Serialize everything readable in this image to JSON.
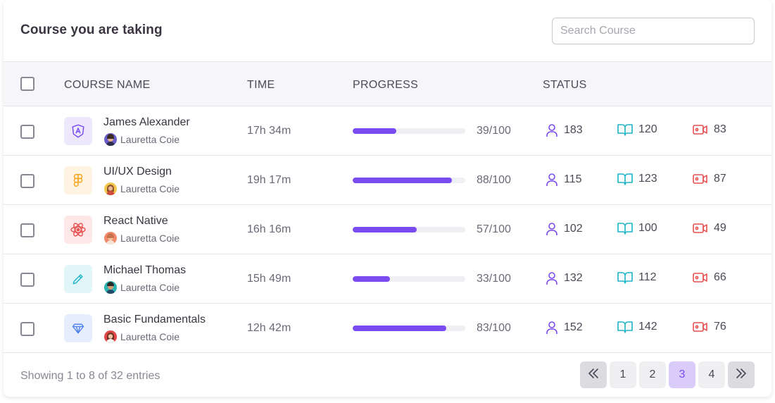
{
  "card": {
    "title": "Course you are taking",
    "search_placeholder": "Search Course"
  },
  "table": {
    "headers": {
      "course_name": "COURSE NAME",
      "time": "TIME",
      "progress": "PROGRESS",
      "status": "STATUS"
    },
    "rows": [
      {
        "course": "James Alexander",
        "icon": "angular-icon",
        "icon_color": "#7a4cf0",
        "icon_bg": "#eee8fd",
        "author": "Lauretta Coie",
        "time": "17h 34m",
        "progress": 39,
        "progress_text": "39/100",
        "users": "183",
        "lessons": "120",
        "videos": "83"
      },
      {
        "course": "UI/UX Design",
        "icon": "figma-icon",
        "icon_color": "#f7a51c",
        "icon_bg": "#fff3e1",
        "author": "Lauretta Coie",
        "time": "19h 17m",
        "progress": 88,
        "progress_text": "88/100",
        "users": "115",
        "lessons": "123",
        "videos": "87"
      },
      {
        "course": "React Native",
        "icon": "react-icon",
        "icon_color": "#ea4f4f",
        "icon_bg": "#fde7e7",
        "author": "Lauretta Coie",
        "time": "16h 16m",
        "progress": 57,
        "progress_text": "57/100",
        "users": "102",
        "lessons": "100",
        "videos": "49"
      },
      {
        "course": "Michael Thomas",
        "icon": "pencil-icon",
        "icon_color": "#1cb4c9",
        "icon_bg": "#e0f6f9",
        "author": "Lauretta Coie",
        "time": "15h 49m",
        "progress": 33,
        "progress_text": "33/100",
        "users": "132",
        "lessons": "112",
        "videos": "66"
      },
      {
        "course": "Basic Fundamentals",
        "icon": "diamond-icon",
        "icon_color": "#4b7cf0",
        "icon_bg": "#e6eefd",
        "author": "Lauretta Coie",
        "time": "12h 42m",
        "progress": 83,
        "progress_text": "83/100",
        "users": "152",
        "lessons": "142",
        "videos": "76"
      }
    ]
  },
  "status_icons": {
    "users": "user-icon",
    "lessons": "book-icon",
    "videos": "video-icon",
    "users_color": "#7a4cf0",
    "lessons_color": "#1cb4c9",
    "videos_color": "#ea4f4f"
  },
  "footer": {
    "showing": "Showing 1 to 8 of 32 entries",
    "pages": [
      "1",
      "2",
      "3",
      "4"
    ],
    "active_page": "3",
    "prev_icon": "double-chevron-left-icon",
    "next_icon": "double-chevron-right-icon"
  },
  "colors": {
    "accent": "#7a4cf0",
    "active_page_bg": "#d9ccfb"
  }
}
